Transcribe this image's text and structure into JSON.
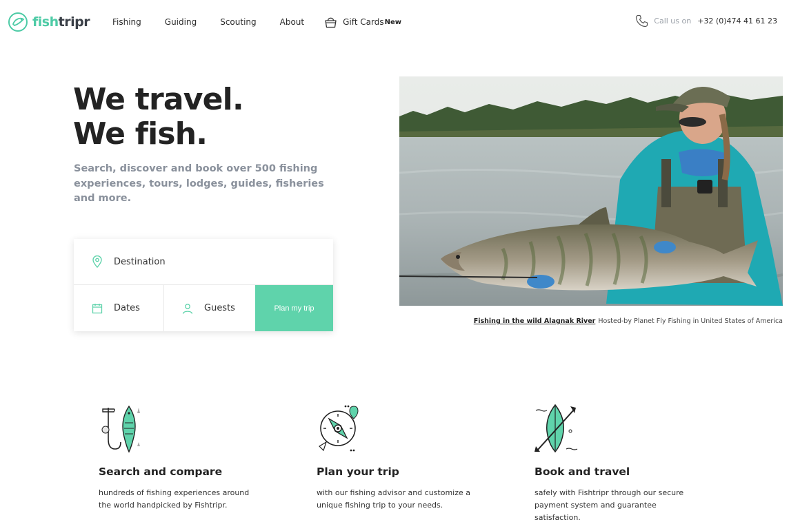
{
  "brand": {
    "name_part1": "fish",
    "name_part2": "tripr",
    "accent": "#5fd3ab"
  },
  "nav": {
    "links": [
      "Fishing",
      "Guiding",
      "Scouting",
      "About"
    ],
    "gift_label": "Gift Cards",
    "gift_badge": "New",
    "call_label": "Call us on",
    "phone": "+32 (0)474 41 61 23"
  },
  "hero": {
    "title_line1": "We travel.",
    "title_line2": "We fish.",
    "subtitle": "Search, discover and book over 500 fishing experiences, tours, lodges, guides, fisheries and more."
  },
  "search": {
    "destination_label": "Destination",
    "dates_label": "Dates",
    "guests_label": "Guests",
    "submit_label": "Plan my trip"
  },
  "caption": {
    "link": "Fishing in the wild Alagnak River",
    "text": "Hosted-by Planet Fly Fishing in United States of America"
  },
  "features": [
    {
      "icon": "fish-hook-icon",
      "title": "Search and compare",
      "text": "hundreds of fishing experiences around the world handpicked by Fishtripr."
    },
    {
      "icon": "compass-icon",
      "title": "Plan your trip",
      "text": "with our fishing advisor and customize a unique fishing trip to your needs."
    },
    {
      "icon": "kayak-icon",
      "title": "Book and travel",
      "text": "safely with Fishtripr through our secure payment system and guarantee satisfaction."
    }
  ]
}
